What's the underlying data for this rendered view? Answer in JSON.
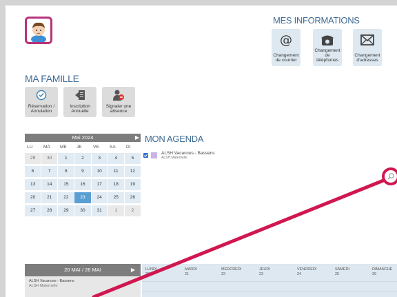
{
  "family_title": "MA FAMILLE",
  "family_actions": [
    {
      "label": "Réservation / Annulation"
    },
    {
      "label": "Inscription Annuelle"
    },
    {
      "label": "Signaler une absence"
    }
  ],
  "info_title": "MES INFORMATIONS",
  "info_actions": [
    {
      "label": "Changement de courriel"
    },
    {
      "label": "Changement de téléphones"
    },
    {
      "label": "Changement d'adresses"
    }
  ],
  "calendar": {
    "month_label": "Mai 2024",
    "weekdays": [
      "LU",
      "MA",
      "ME",
      "JE",
      "VE",
      "SA",
      "DI"
    ],
    "weeks": [
      [
        "29",
        "30",
        "1",
        "2",
        "3",
        "4",
        "5"
      ],
      [
        "6",
        "7",
        "8",
        "9",
        "10",
        "11",
        "12"
      ],
      [
        "13",
        "14",
        "15",
        "16",
        "17",
        "18",
        "19"
      ],
      [
        "20",
        "21",
        "22",
        "23",
        "24",
        "25",
        "26"
      ],
      [
        "27",
        "28",
        "29",
        "30",
        "31",
        "1",
        "2"
      ]
    ],
    "selected_day": "23"
  },
  "agenda": {
    "title": "MON AGENDA",
    "item_title": "ALSH Vacances - Bassens",
    "item_subtitle": "ALSH Maternelle"
  },
  "week": {
    "range_label": "20 MAI / 26 MAI",
    "item_title": "ALSH Vacances - Bassens",
    "item_subtitle": "ALSH Maternelle",
    "days": [
      {
        "name": "LUNDI",
        "num": "20"
      },
      {
        "name": "MARDI",
        "num": "21"
      },
      {
        "name": "MERCREDI",
        "num": "22"
      },
      {
        "name": "JEUDI",
        "num": "23"
      },
      {
        "name": "VENDREDI",
        "num": "24"
      },
      {
        "name": "SAMEDI",
        "num": "25"
      },
      {
        "name": "DIMANCHE",
        "num": "26"
      }
    ]
  },
  "colors": {
    "accent_blue": "#3f6b93",
    "annotation_pink": "#d0174f",
    "avatar_border": "#b8327a",
    "selected_day": "#5a9fd3"
  }
}
